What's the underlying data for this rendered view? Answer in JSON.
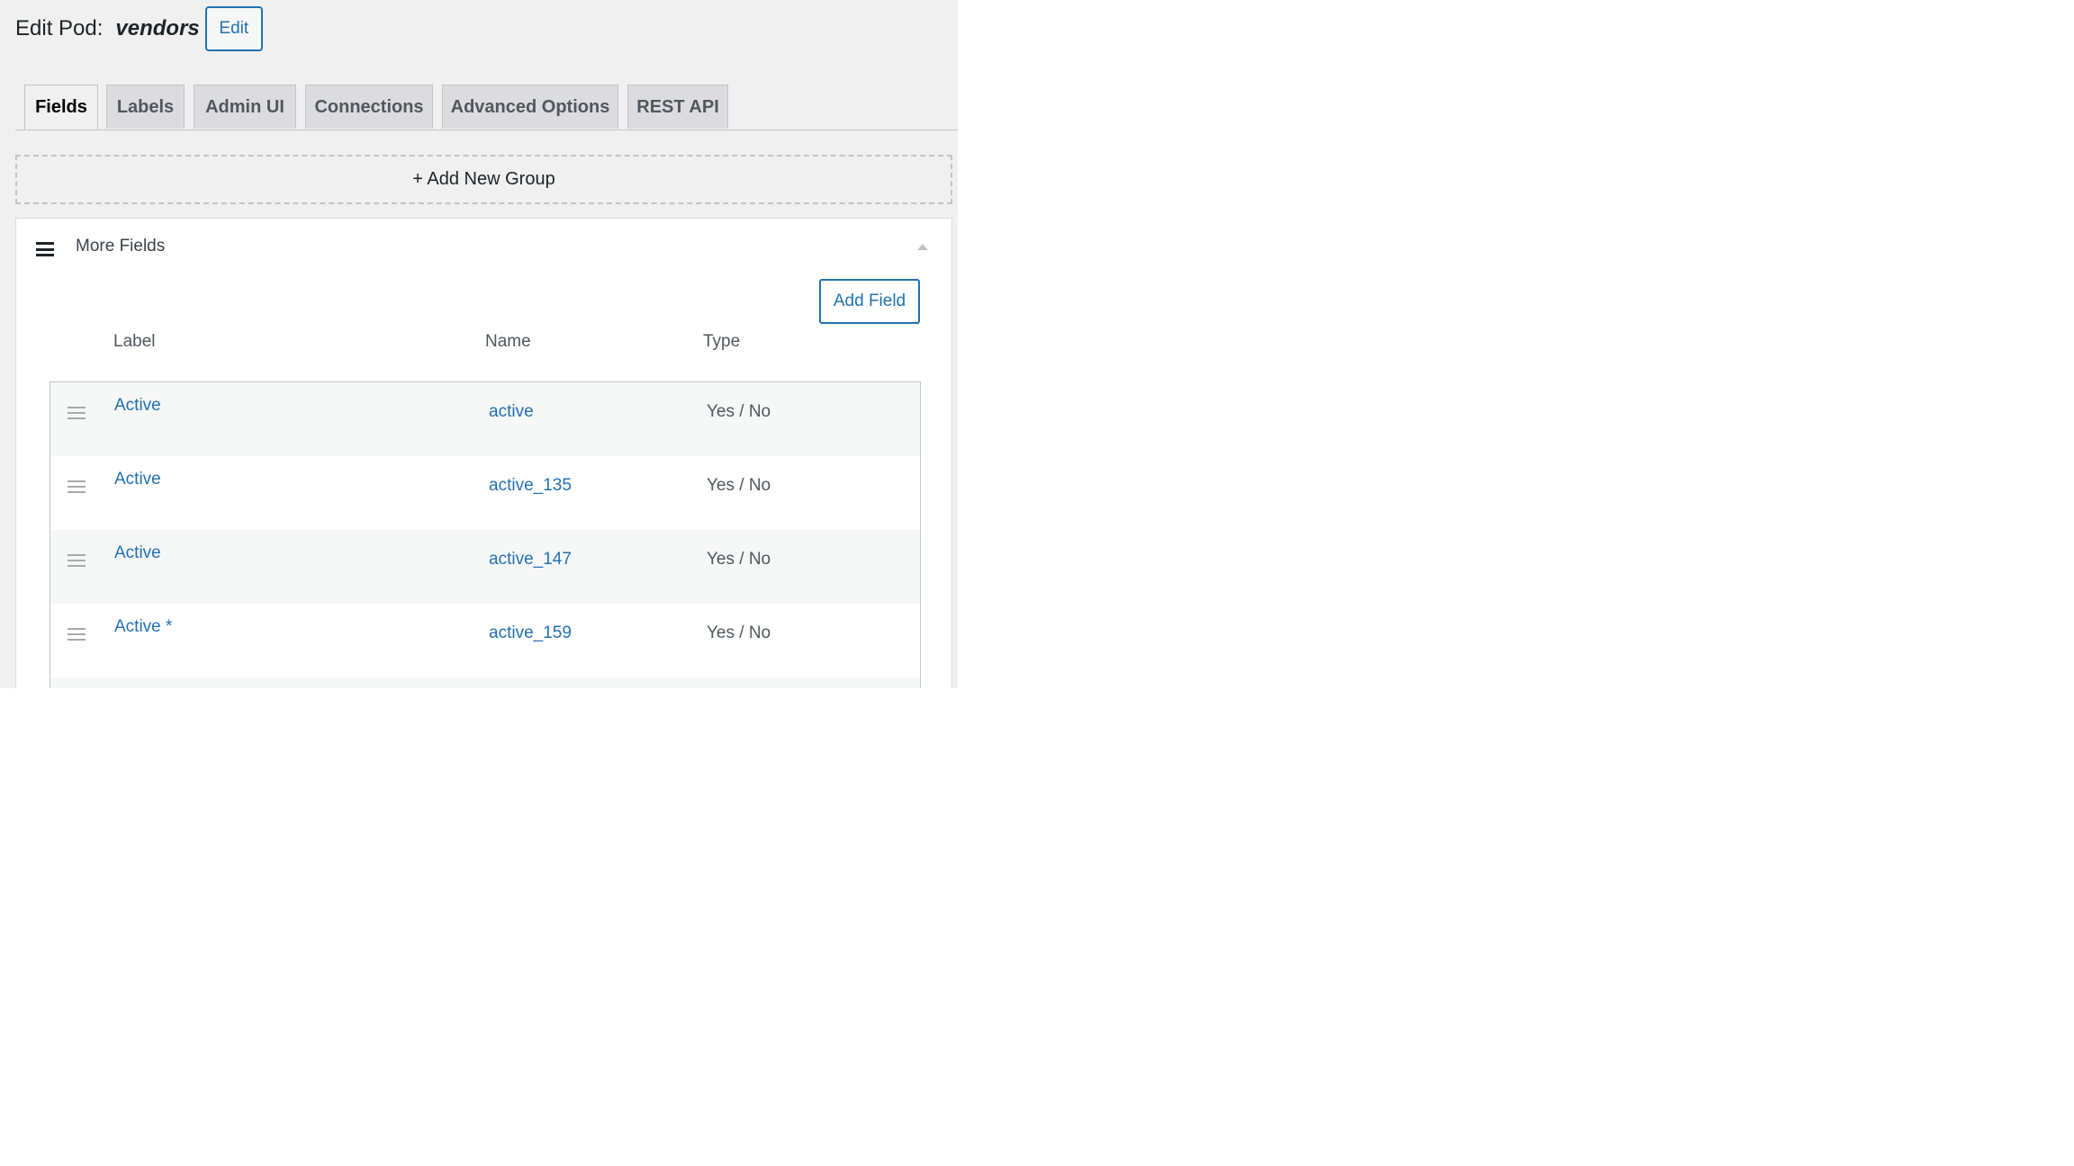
{
  "header": {
    "title": "Edit Pod:",
    "pod_name": "vendors",
    "edit_label": "Edit"
  },
  "tabs": [
    {
      "label": "Fields",
      "active": true
    },
    {
      "label": "Labels",
      "active": false
    },
    {
      "label": "Admin UI",
      "active": false
    },
    {
      "label": "Connections",
      "active": false
    },
    {
      "label": "Advanced Options",
      "active": false
    },
    {
      "label": "REST API",
      "active": false
    }
  ],
  "add_group_label": "+ Add New Group",
  "group": {
    "title": "More Fields",
    "add_field_label": "Add Field",
    "columns": {
      "label": "Label",
      "name": "Name",
      "type": "Type"
    },
    "fields": [
      {
        "label": "Active",
        "name": "active",
        "type": "Yes / No"
      },
      {
        "label": "Active",
        "name": "active_135",
        "type": "Yes / No"
      },
      {
        "label": "Active",
        "name": "active_147",
        "type": "Yes / No"
      },
      {
        "label": "Active *",
        "name": "active_159",
        "type": "Yes / No"
      }
    ]
  },
  "colors": {
    "link": "#2271b1",
    "background": "#f0f0f1",
    "border": "#c3c4c7"
  }
}
